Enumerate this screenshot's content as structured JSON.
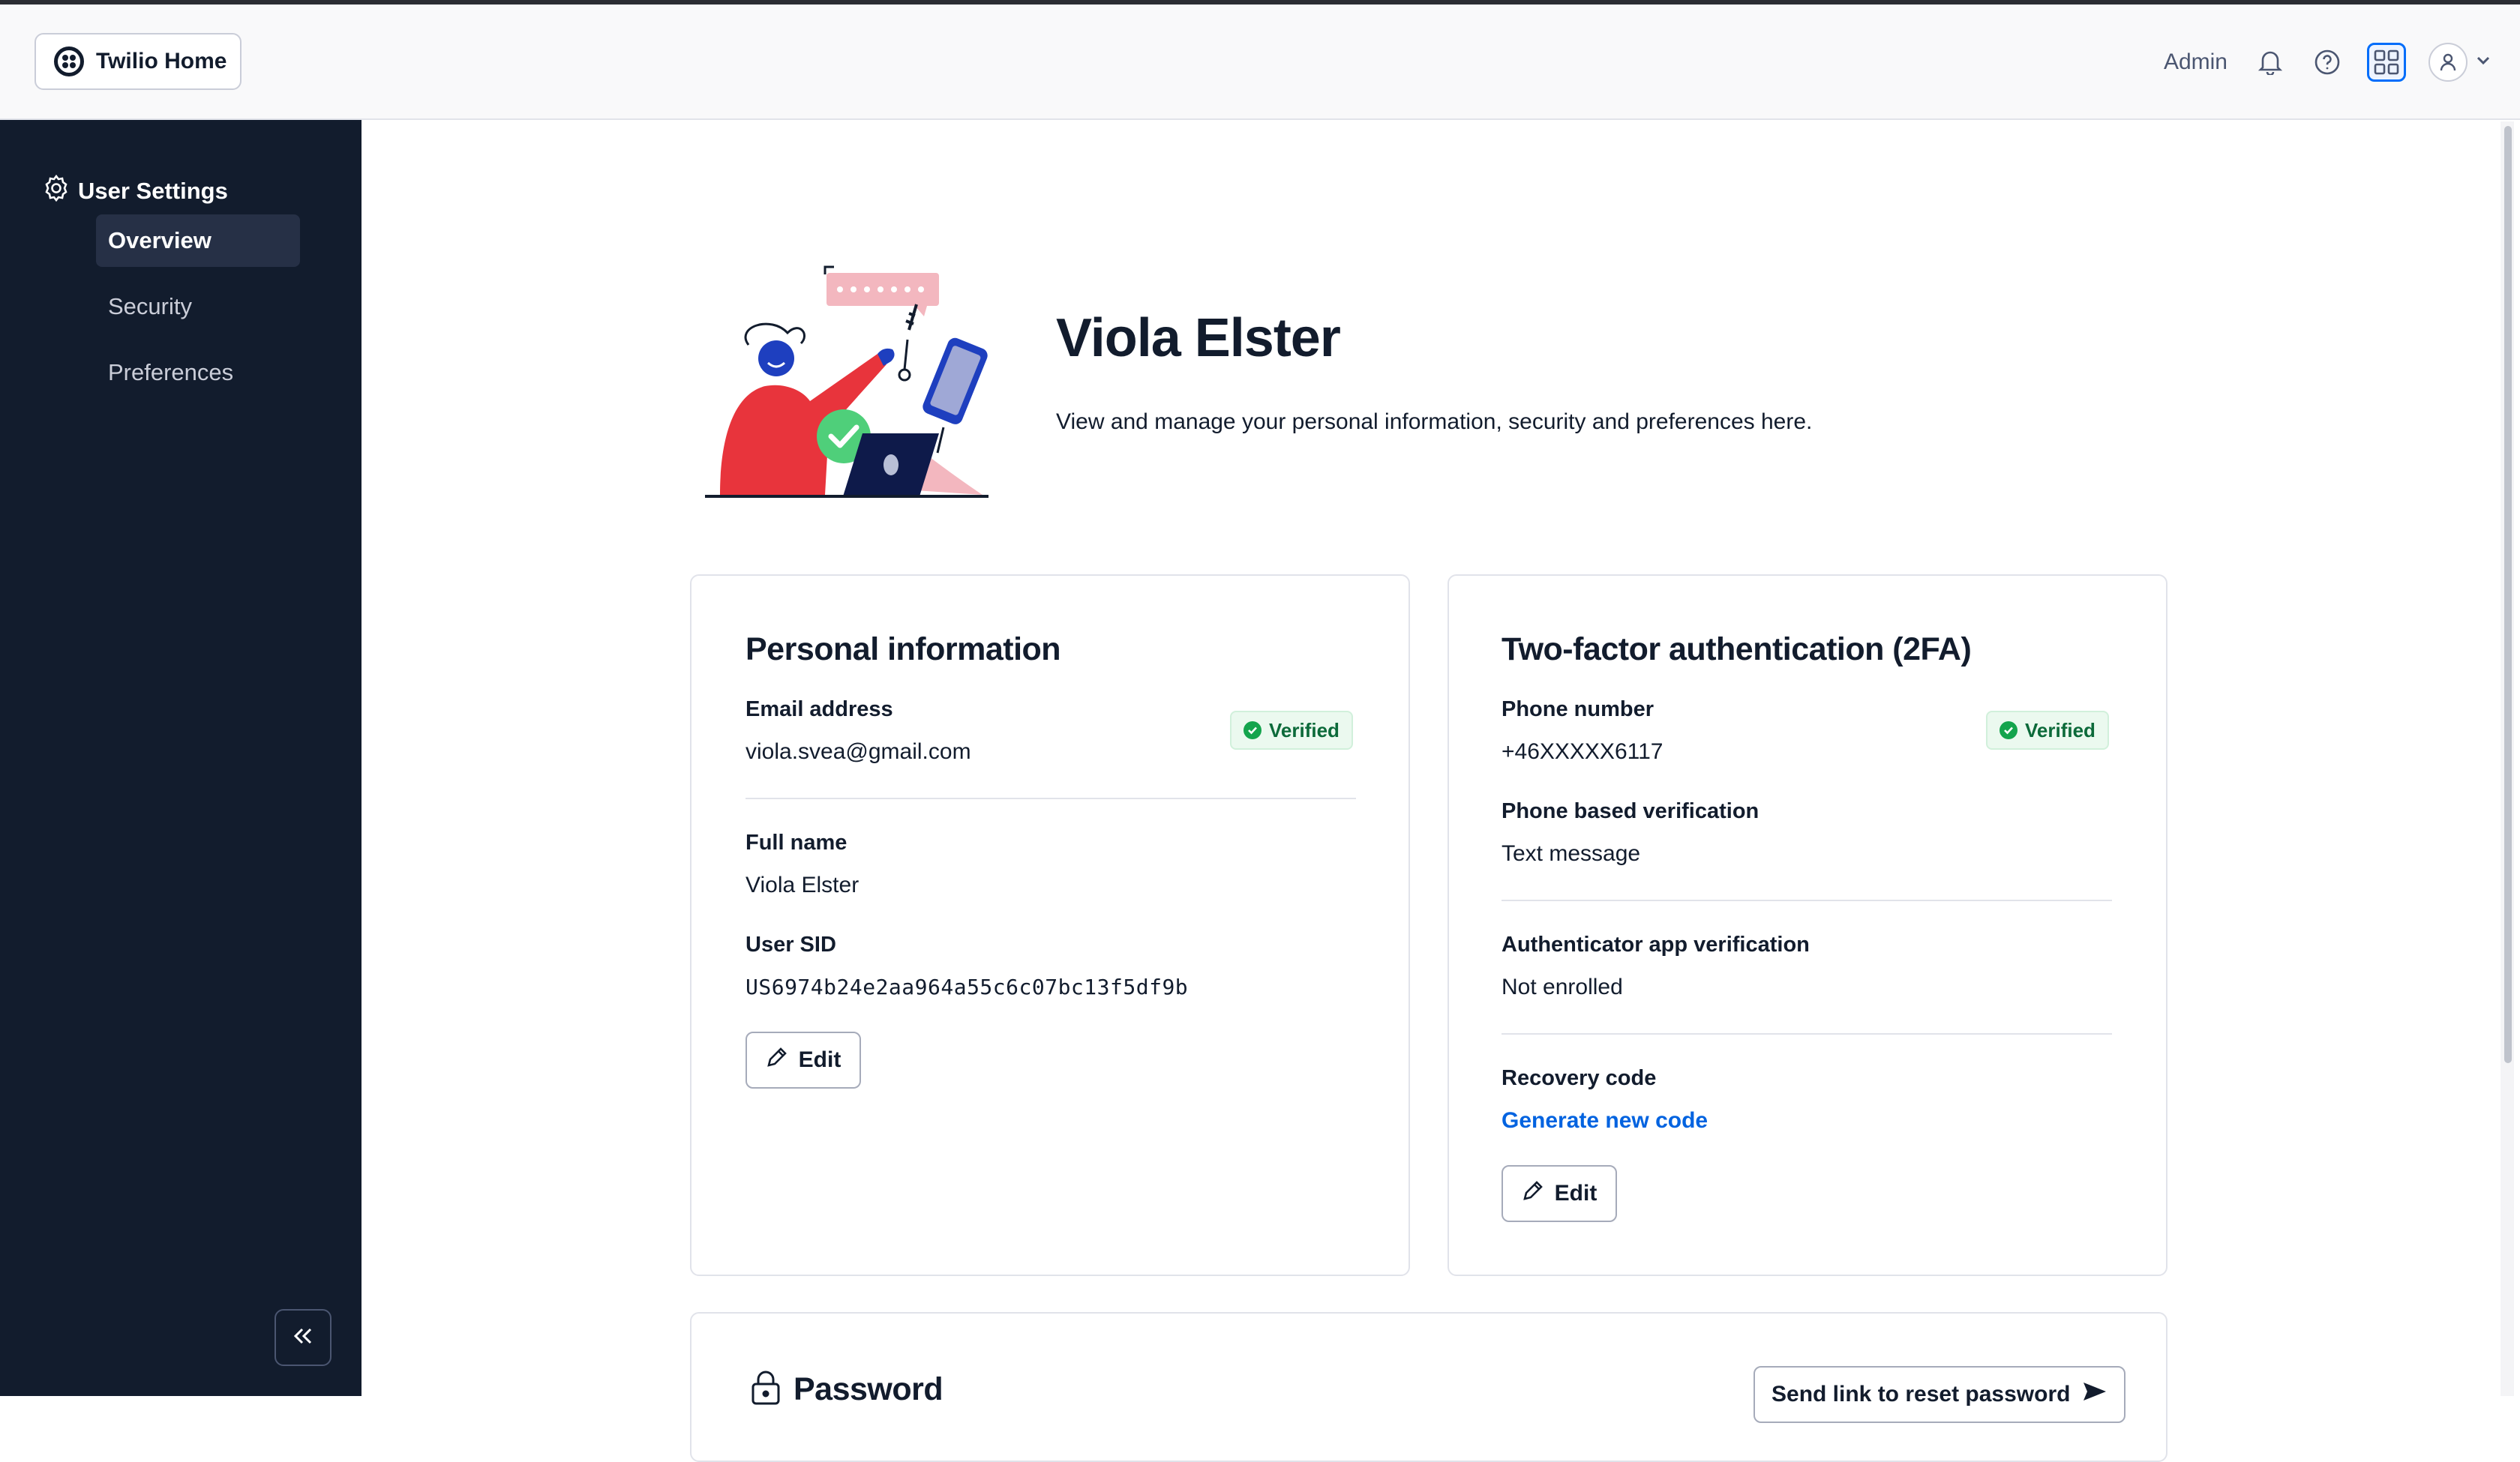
{
  "header": {
    "home_label": "Twilio Home",
    "account_label": "Admin",
    "icons": [
      "bell-icon",
      "help-icon",
      "apps-grid-icon",
      "user-avatar-icon",
      "chevron-down-icon"
    ]
  },
  "sidebar": {
    "title": "User Settings",
    "items": [
      {
        "label": "Overview",
        "active": true
      },
      {
        "label": "Security",
        "active": false
      },
      {
        "label": "Preferences",
        "active": false
      }
    ]
  },
  "hero": {
    "name": "Viola Elster",
    "subtitle": "View and manage your personal information, security and preferences here."
  },
  "personal_info": {
    "title": "Personal information",
    "email_label": "Email address",
    "email_value": "viola.svea@gmail.com",
    "email_badge": "Verified",
    "name_label": "Full name",
    "name_value": "Viola Elster",
    "sid_label": "User SID",
    "sid_value": "US6974b24e2aa964a55c6c07bc13f5df9b",
    "edit_label": "Edit"
  },
  "two_factor": {
    "title": "Two-factor authentication (2FA)",
    "phone_label": "Phone number",
    "phone_value": "+46XXXXX6117",
    "phone_badge": "Verified",
    "phone_verif_label": "Phone based verification",
    "phone_verif_value": "Text message",
    "app_verif_label": "Authenticator app verification",
    "app_verif_value": "Not enrolled",
    "recovery_label": "Recovery code",
    "recovery_link": "Generate new code",
    "edit_label": "Edit"
  },
  "password": {
    "title": "Password",
    "reset_label": "Send link to reset password"
  },
  "colors": {
    "sidebar_bg": "#121c2d",
    "link": "#0263e0",
    "success": "#14a44d",
    "accent": "#006dfa"
  }
}
